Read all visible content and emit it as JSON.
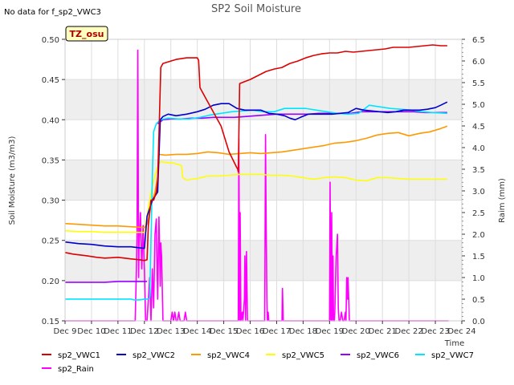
{
  "chart_data": {
    "type": "line",
    "title": "SP2 Soil Moisture",
    "note": "No data for f_sp2_VWC3",
    "badge": "TZ_osu",
    "xlabel": "Time",
    "ylabel": "Soil Moisture (m3/m3)",
    "y2label": "Raim (mm)",
    "xlim": [
      0,
      15
    ],
    "x_ticks": [
      "Dec 9",
      "Dec 10",
      "Dec 11",
      "Dec 12",
      "Dec 13",
      "Dec 14",
      "Dec 15",
      "Dec 16",
      "Dec 17",
      "Dec 18",
      "Dec 19",
      "Dec 20",
      "Dec 21",
      "Dec 22",
      "Dec 23",
      "Dec 24"
    ],
    "ylim": [
      0.15,
      0.5
    ],
    "y_ticks": [
      "0.15",
      "0.20",
      "0.25",
      "0.30",
      "0.35",
      "0.40",
      "0.45",
      "0.50"
    ],
    "y2lim": [
      0.0,
      6.5
    ],
    "y2_ticks": [
      "0.0",
      "0.5",
      "1.0",
      "1.5",
      "2.0",
      "2.5",
      "3.0",
      "3.5",
      "4.0",
      "4.5",
      "5.0",
      "5.5",
      "6.0",
      "6.5"
    ],
    "grid": "horizontal bands",
    "legend_position": "bottom",
    "series": [
      {
        "name": "sp2_VWC1",
        "color": "#dd0000",
        "axis": "left",
        "x": [
          0.0,
          0.3,
          0.8,
          1.2,
          1.5,
          2.0,
          2.5,
          2.8,
          3.0,
          3.1,
          3.15,
          3.25,
          3.35,
          3.45,
          3.5,
          3.55,
          3.62,
          3.7,
          3.9,
          4.2,
          4.6,
          5.0,
          5.05,
          5.1,
          5.3,
          5.6,
          5.9,
          6.2,
          6.5,
          6.52,
          6.55,
          6.6,
          6.75,
          7.0,
          7.3,
          7.6,
          7.9,
          8.2,
          8.5,
          8.8,
          9.1,
          9.4,
          9.7,
          10.0,
          10.3,
          10.6,
          10.9,
          11.2,
          11.5,
          11.8,
          12.1,
          12.4,
          12.7,
          13.0,
          13.3,
          13.6,
          13.9,
          14.2,
          14.45
        ],
        "y": [
          0.235,
          0.233,
          0.231,
          0.229,
          0.228,
          0.229,
          0.227,
          0.226,
          0.225,
          0.226,
          0.268,
          0.3,
          0.3,
          0.31,
          0.325,
          0.38,
          0.465,
          0.47,
          0.472,
          0.475,
          0.477,
          0.477,
          0.474,
          0.44,
          0.428,
          0.41,
          0.392,
          0.36,
          0.34,
          0.34,
          0.335,
          0.445,
          0.447,
          0.45,
          0.455,
          0.46,
          0.463,
          0.465,
          0.47,
          0.473,
          0.477,
          0.48,
          0.482,
          0.483,
          0.483,
          0.485,
          0.484,
          0.485,
          0.486,
          0.487,
          0.488,
          0.49,
          0.49,
          0.49,
          0.491,
          0.492,
          0.493,
          0.492,
          0.492
        ]
      },
      {
        "name": "sp2_VWC2",
        "color": "#0000cc",
        "axis": "left",
        "x": [
          0.0,
          0.5,
          1.0,
          1.5,
          2.0,
          2.5,
          3.0,
          3.1,
          3.2,
          3.3,
          3.4,
          3.5,
          3.6,
          3.7,
          3.9,
          4.2,
          4.6,
          5.0,
          5.3,
          5.6,
          5.9,
          6.2,
          6.5,
          6.8,
          7.1,
          7.4,
          7.7,
          8.0,
          8.3,
          8.5,
          8.7,
          8.9,
          9.2,
          9.5,
          9.8,
          10.1,
          10.4,
          10.7,
          11.0,
          11.3,
          11.6,
          11.9,
          12.2,
          12.5,
          12.8,
          13.1,
          13.4,
          13.7,
          14.0,
          14.2,
          14.45
        ],
        "y": [
          0.248,
          0.246,
          0.245,
          0.243,
          0.242,
          0.242,
          0.24,
          0.28,
          0.29,
          0.3,
          0.305,
          0.31,
          0.4,
          0.404,
          0.407,
          0.405,
          0.407,
          0.41,
          0.413,
          0.418,
          0.42,
          0.42,
          0.414,
          0.412,
          0.412,
          0.412,
          0.408,
          0.407,
          0.405,
          0.402,
          0.4,
          0.403,
          0.407,
          0.407,
          0.407,
          0.407,
          0.408,
          0.409,
          0.414,
          0.412,
          0.411,
          0.41,
          0.409,
          0.41,
          0.412,
          0.412,
          0.412,
          0.413,
          0.415,
          0.418,
          0.422
        ]
      },
      {
        "name": "sp2_VWC4",
        "color": "#ff9900",
        "axis": "left",
        "x": [
          0.0,
          0.5,
          1.0,
          1.5,
          2.0,
          2.5,
          3.0,
          3.1,
          3.2,
          3.3,
          3.4,
          3.5,
          3.55,
          3.8,
          4.2,
          4.6,
          5.0,
          5.4,
          5.8,
          6.2,
          6.6,
          7.0,
          7.4,
          7.8,
          8.2,
          8.6,
          9.0,
          9.4,
          9.8,
          10.2,
          10.6,
          11.0,
          11.4,
          11.8,
          12.2,
          12.6,
          13.0,
          13.4,
          13.8,
          14.2,
          14.45
        ],
        "y": [
          0.271,
          0.27,
          0.269,
          0.268,
          0.268,
          0.267,
          0.266,
          0.27,
          0.285,
          0.3,
          0.31,
          0.33,
          0.357,
          0.356,
          0.357,
          0.357,
          0.358,
          0.36,
          0.359,
          0.357,
          0.358,
          0.359,
          0.358,
          0.359,
          0.36,
          0.362,
          0.364,
          0.366,
          0.368,
          0.371,
          0.372,
          0.374,
          0.377,
          0.381,
          0.383,
          0.384,
          0.38,
          0.383,
          0.385,
          0.389,
          0.392
        ]
      },
      {
        "name": "sp2_VWC5",
        "color": "#ffff00",
        "axis": "left",
        "x": [
          0.0,
          0.5,
          1.0,
          1.5,
          2.0,
          2.5,
          3.0,
          3.1,
          3.2,
          3.3,
          3.4,
          3.5,
          3.6,
          3.8,
          4.1,
          4.4,
          4.45,
          4.6,
          5.0,
          5.4,
          5.8,
          6.2,
          6.6,
          7.0,
          7.4,
          7.8,
          8.2,
          8.6,
          9.0,
          9.4,
          9.8,
          10.2,
          10.6,
          11.0,
          11.4,
          11.8,
          12.2,
          12.6,
          13.0,
          13.4,
          13.8,
          14.2,
          14.45
        ],
        "y": [
          0.262,
          0.261,
          0.261,
          0.26,
          0.26,
          0.26,
          0.26,
          0.28,
          0.3,
          0.318,
          0.33,
          0.342,
          0.348,
          0.347,
          0.346,
          0.343,
          0.328,
          0.325,
          0.327,
          0.33,
          0.33,
          0.331,
          0.332,
          0.332,
          0.332,
          0.331,
          0.331,
          0.33,
          0.328,
          0.326,
          0.328,
          0.329,
          0.328,
          0.325,
          0.324,
          0.328,
          0.328,
          0.327,
          0.326,
          0.326,
          0.326,
          0.326,
          0.326
        ]
      },
      {
        "name": "sp2_VWC6",
        "color": "#9900ff",
        "axis": "left",
        "x": [
          0.0,
          0.5,
          1.0,
          1.5,
          2.0,
          2.5,
          2.6,
          2.8,
          3.1
        ],
        "y": [
          0.198,
          0.198,
          0.198,
          0.198,
          0.199,
          0.199,
          0.199,
          0.199,
          0.199
        ]
      },
      {
        "name": "sp2_VWC6b",
        "color": "#9900ff",
        "axis": "left",
        "x": [
          3.5,
          3.7,
          4.0,
          4.4,
          4.8,
          5.2,
          5.6,
          6.0,
          6.4,
          6.8,
          7.2,
          7.6,
          8.0,
          8.4,
          8.8,
          9.2,
          9.6,
          10.0,
          10.4,
          10.8,
          11.2,
          11.6,
          12.0,
          12.4,
          12.8,
          13.2,
          13.6,
          14.0,
          14.45
        ],
        "y": [
          0.395,
          0.4,
          0.401,
          0.401,
          0.402,
          0.402,
          0.403,
          0.403,
          0.403,
          0.404,
          0.405,
          0.406,
          0.407,
          0.407,
          0.407,
          0.407,
          0.408,
          0.408,
          0.408,
          0.408,
          0.41,
          0.41,
          0.41,
          0.41,
          0.41,
          0.41,
          0.409,
          0.409,
          0.409
        ]
      },
      {
        "name": "sp2_VWC7",
        "color": "#00e5ff",
        "axis": "left",
        "x": [
          0.0,
          0.5,
          1.0,
          1.5,
          2.0,
          2.5,
          2.6,
          2.8,
          3.0,
          3.1,
          3.2,
          3.25,
          3.3,
          3.35,
          3.45,
          3.6,
          3.9,
          4.3,
          4.7,
          5.1,
          5.5,
          5.9,
          6.3,
          6.7,
          7.1,
          7.5,
          7.9,
          8.3,
          8.7,
          9.1,
          9.5,
          9.9,
          10.3,
          10.7,
          11.1,
          11.5,
          11.9,
          12.3,
          12.7,
          13.1,
          13.5,
          13.9,
          14.45
        ],
        "y": [
          0.177,
          0.177,
          0.177,
          0.177,
          0.177,
          0.177,
          0.176,
          0.176,
          0.177,
          0.177,
          0.178,
          0.25,
          0.33,
          0.385,
          0.395,
          0.4,
          0.402,
          0.401,
          0.401,
          0.403,
          0.406,
          0.408,
          0.41,
          0.411,
          0.412,
          0.41,
          0.41,
          0.414,
          0.414,
          0.414,
          0.412,
          0.41,
          0.408,
          0.407,
          0.408,
          0.418,
          0.416,
          0.414,
          0.413,
          0.412,
          0.41,
          0.409,
          0.408
        ]
      },
      {
        "name": "sp2_Rain",
        "color": "#ff00ff",
        "axis": "right",
        "x": [
          0.0,
          2.65,
          2.7,
          2.72,
          2.75,
          2.78,
          2.8,
          2.85,
          2.9,
          2.95,
          3.0,
          3.05,
          3.1,
          3.15,
          3.2,
          3.25,
          3.3,
          3.35,
          3.4,
          3.45,
          3.5,
          3.55,
          3.6,
          3.62,
          3.65,
          3.7,
          3.75,
          3.8,
          3.85,
          3.9,
          3.95,
          4.0,
          4.05,
          4.1,
          4.15,
          4.2,
          4.25,
          4.3,
          4.35,
          4.4,
          4.5,
          4.55,
          4.6,
          4.65,
          6.5,
          6.55,
          6.57,
          6.6,
          6.62,
          6.65,
          6.7,
          6.72,
          6.75,
          6.78,
          6.8,
          6.83,
          6.86,
          6.9,
          6.92,
          6.95,
          6.98,
          7.0,
          7.5,
          7.55,
          7.58,
          7.6,
          7.63,
          7.65,
          7.68,
          7.7,
          7.73,
          7.75,
          7.78,
          7.82,
          8.2,
          8.22,
          8.25,
          8.3,
          8.5,
          10.0,
          10.02,
          10.05,
          10.08,
          10.1,
          10.13,
          10.15,
          10.18,
          10.2,
          10.25,
          10.3,
          10.33,
          10.36,
          10.4,
          10.45,
          10.5,
          10.55,
          10.6,
          10.62,
          10.65,
          10.68,
          10.7,
          10.75,
          10.8,
          11.0,
          14.5
        ],
        "y": [
          0.0,
          0.0,
          1.2,
          2.0,
          6.25,
          1.0,
          1.8,
          2.5,
          1.2,
          2.2,
          1.2,
          0.0,
          0.0,
          0.5,
          1.0,
          0.0,
          1.2,
          0.3,
          2.0,
          2.35,
          0.5,
          2.4,
          0.8,
          1.8,
          1.5,
          0.0,
          0.0,
          0.0,
          0.0,
          0.0,
          0.0,
          0.0,
          0.2,
          0.0,
          0.2,
          0.0,
          0.0,
          0.2,
          0.0,
          0.0,
          0.0,
          0.2,
          0.0,
          0.0,
          0.0,
          0.0,
          4.2,
          0.0,
          2.5,
          0.0,
          0.2,
          0.0,
          0.2,
          0.5,
          1.5,
          0.0,
          1.6,
          0.0,
          0.0,
          0.0,
          0.0,
          0.0,
          0.0,
          0.0,
          4.3,
          2.5,
          0.5,
          0.0,
          0.2,
          0.0,
          0.0,
          0.0,
          0.0,
          0.0,
          0.0,
          0.75,
          0.0,
          0.0,
          0.0,
          0.0,
          3.2,
          0.0,
          2.5,
          0.0,
          1.5,
          0.0,
          0.0,
          0.2,
          1.5,
          2.0,
          0.3,
          0.0,
          0.0,
          0.2,
          0.0,
          0.0,
          0.2,
          0.0,
          1.0,
          0.5,
          1.0,
          0.0,
          0.0,
          0.0,
          0.0
        ]
      }
    ]
  },
  "legend": [
    {
      "label": "sp2_VWC1",
      "color": "#dd0000"
    },
    {
      "label": "sp2_VWC2",
      "color": "#0000cc"
    },
    {
      "label": "sp2_VWC4",
      "color": "#ff9900"
    },
    {
      "label": "sp2_VWC5",
      "color": "#ffff00"
    },
    {
      "label": "sp2_VWC6",
      "color": "#9900ff"
    },
    {
      "label": "sp2_VWC7",
      "color": "#00e5ff"
    },
    {
      "label": "sp2_Rain",
      "color": "#ff00ff"
    }
  ]
}
